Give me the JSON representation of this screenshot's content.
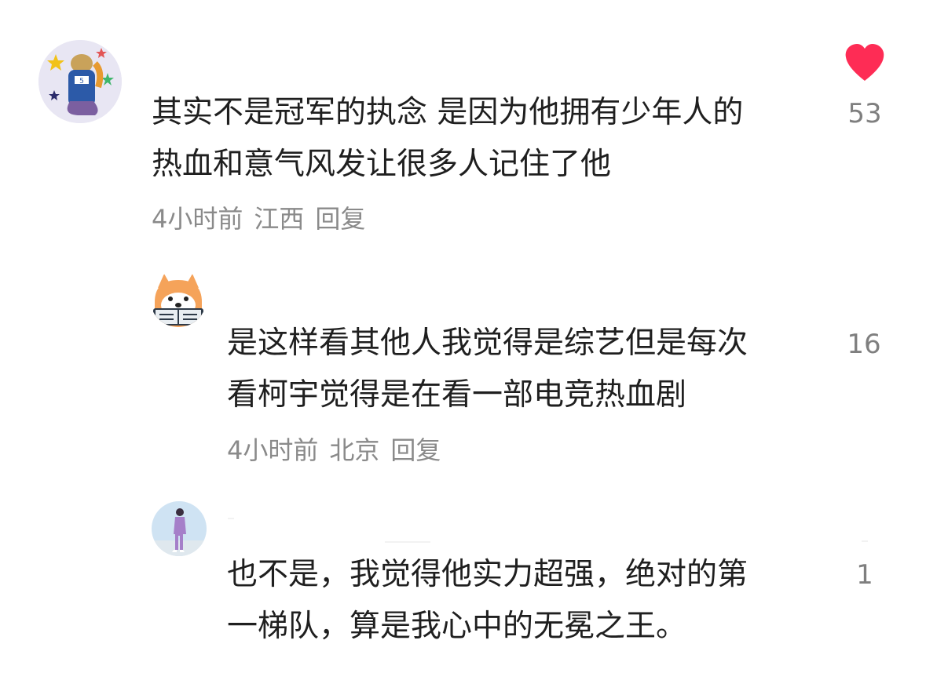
{
  "colors": {
    "text": "#1f1f1f",
    "meta": "#8a8a8a",
    "like_active": "#fe2c55",
    "like_count": "#7f7f7f"
  },
  "comments": [
    {
      "avatar_icon": "avatar-cartoon-character-with-stars",
      "text_lines": [
        "其实不是冠军的执念 是因为他拥有少年人的",
        "热血和意气风发让很多人记住了他"
      ],
      "time": "4小时前",
      "location": "江西",
      "reply_label": "回复",
      "like_count": "53",
      "liked": true,
      "like_icon": "heart-filled-icon"
    },
    {
      "avatar_icon": "avatar-shiba-dog-with-book",
      "text_lines": [
        "是这样看其他人我觉得是综艺但是每次",
        "看柯宇觉得是在看一部电竞热血剧"
      ],
      "time": "4小时前",
      "location": "北京",
      "reply_label": "回复",
      "like_count": "16"
    },
    {
      "avatar_icon": "avatar-person-standing-photo",
      "text_lines": [
        "也不是，我觉得他实力超强，绝对的第",
        "一梯队，算是我心中的无冕之王。"
      ],
      "like_count": "1"
    }
  ]
}
